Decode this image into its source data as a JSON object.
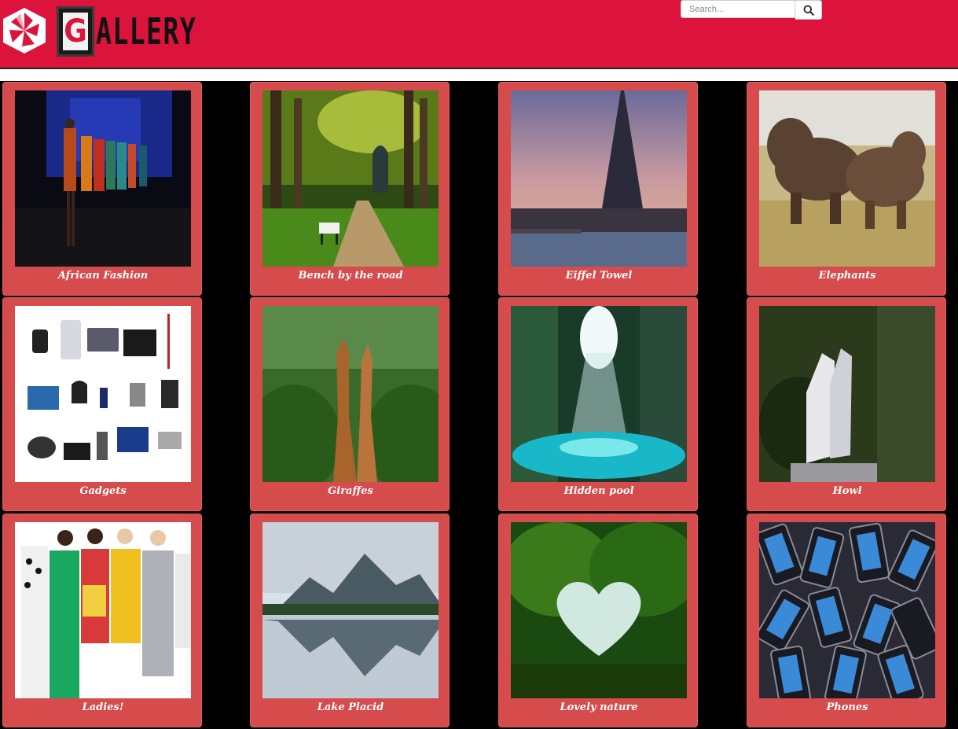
{
  "header": {
    "logo_letter": "G",
    "logo_rest": "ALLERY",
    "brand_color": "#dc143c"
  },
  "search": {
    "placeholder": "Search...",
    "button_icon": "search-icon"
  },
  "gallery": {
    "items": [
      {
        "caption": "African Fashion"
      },
      {
        "caption": "Bench by the road"
      },
      {
        "caption": "Eiffel Towel"
      },
      {
        "caption": "Elephants"
      },
      {
        "caption": "Gadgets"
      },
      {
        "caption": "Giraffes"
      },
      {
        "caption": "Hidden pool"
      },
      {
        "caption": "Howl"
      },
      {
        "caption": "Ladies!"
      },
      {
        "caption": "Lake Placid"
      },
      {
        "caption": "Lovely nature"
      },
      {
        "caption": "Phones"
      }
    ]
  }
}
